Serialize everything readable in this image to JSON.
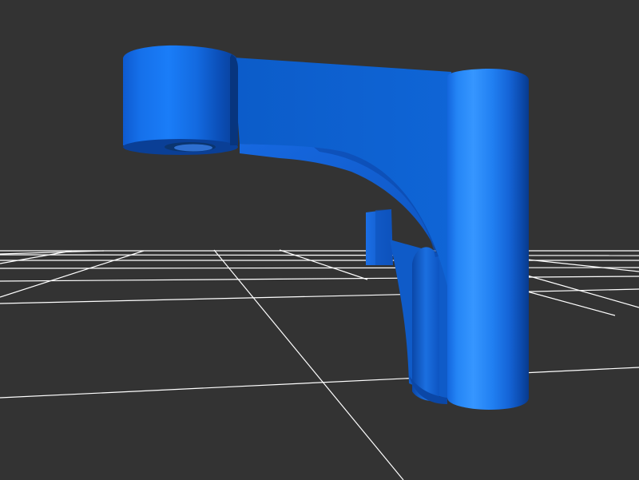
{
  "viewport": {
    "background_color": "#333333"
  },
  "grid": {
    "line_color": "#ffffff",
    "visible": true
  },
  "model": {
    "base_color": "#1a73f0",
    "highlight_color": "#3a95ff",
    "shadow_color": "#0a47a8",
    "hole_color": "#0b3570"
  }
}
